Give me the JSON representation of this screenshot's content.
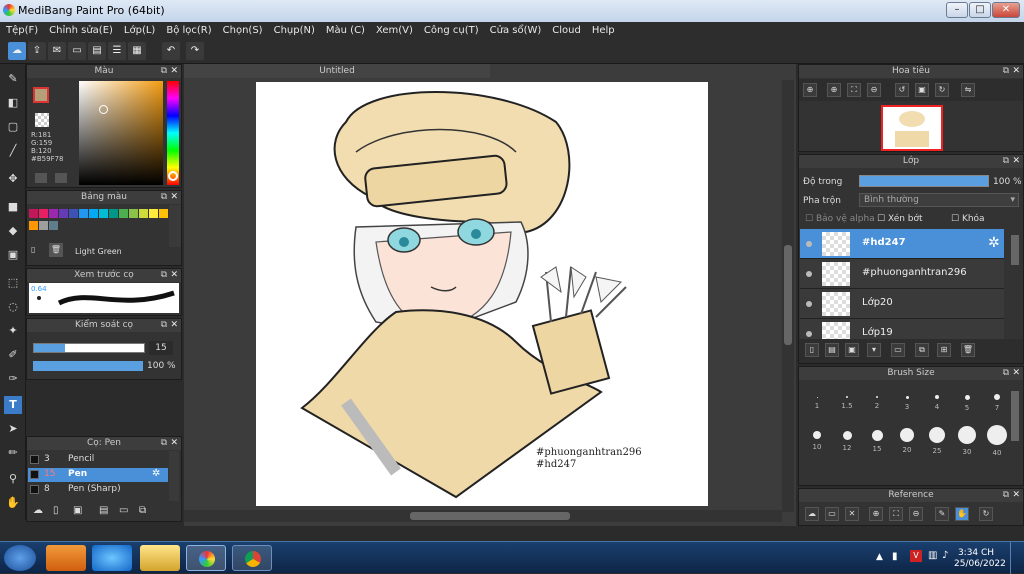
{
  "window": {
    "title": "MediBang Paint Pro (64bit)",
    "minimize": "–",
    "maximize": "□",
    "close": "✕"
  },
  "menu": [
    "Tệp(F)",
    "Chỉnh sửa(E)",
    "Lớp(L)",
    "Bộ lọc(R)",
    "Chọn(S)",
    "Chụp(N)",
    "Màu (C)",
    "Xem(V)",
    "Công cụ(T)",
    "Cửa sổ(W)",
    "Cloud",
    "Help"
  ],
  "color_panel": {
    "title": "Màu",
    "r": "R:181",
    "g": "G:159",
    "b": "B:120",
    "hex": "#B59F78",
    "accent": "#B59F78"
  },
  "palette_panel": {
    "title": "Bảng màu",
    "current": "Light Green",
    "swatches": [
      "#c2185b",
      "#e91e63",
      "#9c27b0",
      "#673ab7",
      "#3f51b5",
      "#2196f3",
      "#03a9f4",
      "#00bcd4",
      "#009688",
      "#4caf50",
      "#8bc34a",
      "#cddc39",
      "#ffeb3b",
      "#ffc107",
      "#ff9800",
      "#9e9e9e",
      "#607d8b"
    ]
  },
  "preview_panel": {
    "title": "Xem trước cọ",
    "size": "0.64"
  },
  "brush_control": {
    "title": "Kiểm soát cọ",
    "size": "15",
    "opacity": "100 %"
  },
  "brush_list": {
    "title": "Cọ: Pen",
    "items": [
      {
        "num": "3",
        "name": "Pencil"
      },
      {
        "num": "15",
        "name": "Pen"
      },
      {
        "num": "8",
        "name": "Pen (Sharp)"
      }
    ]
  },
  "canvas": {
    "tab": "Untitled",
    "sig1": "#phuonganhtran296",
    "sig2": "#hd247"
  },
  "navigator": {
    "title": "Hoa tiêu"
  },
  "layers": {
    "title": "Lớp",
    "opacity_label": "Độ trong",
    "opacity_value": "100 %",
    "blend_label": "Pha trộn",
    "blend_value": "Bình thường",
    "protect_alpha": "Bảo vệ alpha",
    "clipping": "Xén bớt",
    "lock": "Khóa",
    "items": [
      {
        "name": "#hd247"
      },
      {
        "name": "#phuonganhtran296"
      },
      {
        "name": "Lớp20"
      },
      {
        "name": "Lớp19"
      }
    ]
  },
  "brush_size": {
    "title": "Brush Size",
    "row1": [
      "1",
      "1.5",
      "2",
      "3",
      "4",
      "5",
      "7"
    ],
    "row2": [
      "10",
      "12",
      "15",
      "20",
      "25",
      "30",
      "40"
    ]
  },
  "reference": {
    "title": "Reference"
  },
  "taskbar": {
    "time": "3:34 CH",
    "date": "25/06/2022"
  }
}
